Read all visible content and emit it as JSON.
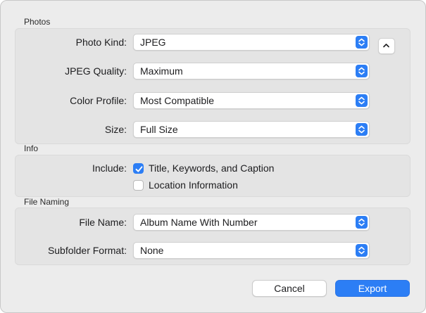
{
  "colors": {
    "accent": "#2c7ef5",
    "dialog_bg": "#ececec",
    "panel_bg": "#e4e4e4"
  },
  "photos": {
    "title": "Photos",
    "photo_kind": {
      "label": "Photo Kind:",
      "value": "JPEG"
    },
    "jpeg_quality": {
      "label": "JPEG Quality:",
      "value": "Maximum"
    },
    "color_profile": {
      "label": "Color Profile:",
      "value": "Most Compatible"
    },
    "size": {
      "label": "Size:",
      "value": "Full Size"
    },
    "disclosure_icon": "chevron-up-icon"
  },
  "info": {
    "title": "Info",
    "include_label": "Include:",
    "title_keywords_caption": {
      "label": "Title, Keywords, and Caption",
      "checked": true
    },
    "location_information": {
      "label": "Location Information",
      "checked": false
    }
  },
  "file_naming": {
    "title": "File Naming",
    "file_name": {
      "label": "File Name:",
      "value": "Album Name With Number"
    },
    "subfolder_format": {
      "label": "Subfolder Format:",
      "value": "None"
    }
  },
  "buttons": {
    "cancel": "Cancel",
    "export": "Export"
  }
}
